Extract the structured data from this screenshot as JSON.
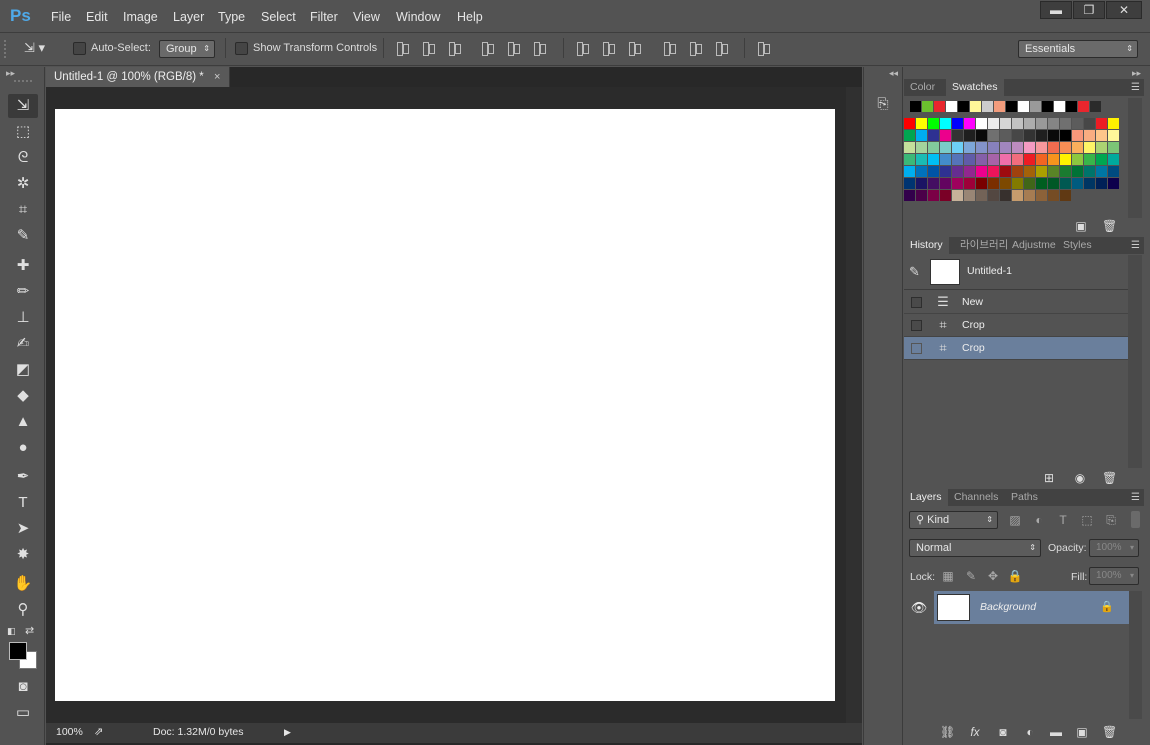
{
  "app": {
    "logo": "Ps"
  },
  "menus": [
    "File",
    "Edit",
    "Image",
    "Layer",
    "Type",
    "Select",
    "Filter",
    "View",
    "Window",
    "Help"
  ],
  "window_controls": {
    "minimize": "▬",
    "restore": "❐",
    "close": "✕"
  },
  "options_bar": {
    "auto_select_label": "Auto-Select:",
    "auto_select_value": "Group",
    "show_transform_label": "Show Transform Controls",
    "workspace": "Essentials"
  },
  "document": {
    "tab_title": "Untitled-1 @ 100% (RGB/8) *",
    "close_icon": "×",
    "zoom": "100%",
    "doc_info": "Doc: 1.32M/0 bytes"
  },
  "swatches_panel": {
    "tabs": [
      "Color",
      "Swatches"
    ],
    "active_tab": "Swatches",
    "recent_colors": [
      "#000000",
      "#6bbf2e",
      "#e8262d",
      "#ffffff",
      "#000000",
      "#fff799",
      "#cccccc",
      "#f29c7d",
      "#000000",
      "#ffffff",
      "#9a9a9a",
      "#000000",
      "#ffffff",
      "#000000",
      "#e8262d",
      "#2b2b2b"
    ],
    "colors": [
      [
        "#ff0000",
        "#ffff00",
        "#00ff00",
        "#00ffff",
        "#0000ff",
        "#ff00ff",
        "#ffffff",
        "#ebebeb",
        "#d6d6d6",
        "#c2c2c2",
        "#adadad",
        "#999999",
        "#858585",
        "#707070",
        "#5c5c5c",
        "#474747",
        "#ed1c24",
        "#fff200"
      ],
      [
        "#00a651",
        "#00aeef",
        "#2e3192",
        "#ec008c",
        "#333333",
        "#1f1f1f",
        "#0a0a0a",
        "#707070",
        "#5c5c5c",
        "#474747",
        "#333333",
        "#1f1f1f",
        "#0a0a0a",
        "#000000",
        "#f7977a",
        "#f9ad81",
        "#fdc68a",
        "#fff79a"
      ],
      [
        "#c4df9b",
        "#a3d39c",
        "#82ca9c",
        "#7accc8",
        "#6dcff6",
        "#7da7d9",
        "#8393ca",
        "#8781bd",
        "#a186be",
        "#bd8cbf",
        "#f49ac2",
        "#f6989d",
        "#f26c4f",
        "#f68e55",
        "#fbaf5c",
        "#fff467",
        "#acd372",
        "#7cc576"
      ],
      [
        "#3bb878",
        "#1abbb4",
        "#00bff3",
        "#438ccb",
        "#5574b9",
        "#605ca8",
        "#855fa8",
        "#a763a8",
        "#f06ea9",
        "#f26d7d",
        "#ed1c24",
        "#f26522",
        "#f7941d",
        "#fff200",
        "#8dc73f",
        "#39b54a",
        "#00a651",
        "#00a99d"
      ],
      [
        "#00aeef",
        "#0072bc",
        "#0054a6",
        "#2e3192",
        "#662d91",
        "#92278f",
        "#ec008c",
        "#ed145b",
        "#9e0b0f",
        "#a0410d",
        "#a36209",
        "#aba000",
        "#598527",
        "#1a7b30",
        "#007236",
        "#00746b",
        "#0076a3",
        "#004b80"
      ],
      [
        "#003471",
        "#1b1464",
        "#440e62",
        "#630460",
        "#9e005d",
        "#9e0039",
        "#790000",
        "#7b2e00",
        "#7d4900",
        "#827b00",
        "#406618",
        "#005e20",
        "#005826",
        "#005952",
        "#005b7f",
        "#003663",
        "#002157",
        "#0d004c"
      ],
      [
        "#32004b",
        "#4b0049",
        "#7b0046",
        "#7a0026",
        "#c7b299",
        "#998675",
        "#736357",
        "#534741",
        "#37302d",
        "#c69c6d",
        "#a67c52",
        "#8c6239",
        "#754c24",
        "#603913"
      ]
    ],
    "footer_icons": [
      "new-swatch-icon",
      "trash-icon"
    ]
  },
  "history_panel": {
    "tabs": [
      "History",
      "라이브러리",
      "Adjustme",
      "Styles"
    ],
    "active_tab": "History",
    "snapshot_label": "Untitled-1",
    "items": [
      {
        "label": "New",
        "icon": "☰",
        "selected": false
      },
      {
        "label": "Crop",
        "icon": "⌗",
        "selected": false
      },
      {
        "label": "Crop",
        "icon": "⌗",
        "selected": true
      }
    ]
  },
  "layers_panel": {
    "tabs": [
      "Layers",
      "Channels",
      "Paths"
    ],
    "active_tab": "Layers",
    "filter_kind": "Kind",
    "blend_mode": "Normal",
    "opacity_label": "Opacity:",
    "opacity_value": "100%",
    "lock_label": "Lock:",
    "fill_label": "Fill:",
    "fill_value": "100%",
    "layers": [
      {
        "name": "Background",
        "visible": true,
        "locked": true
      }
    ],
    "footer_icons": [
      "link-layers-icon",
      "fx-icon",
      "mask-icon",
      "adjustment-icon",
      "group-icon",
      "new-layer-icon",
      "trash-icon"
    ]
  }
}
